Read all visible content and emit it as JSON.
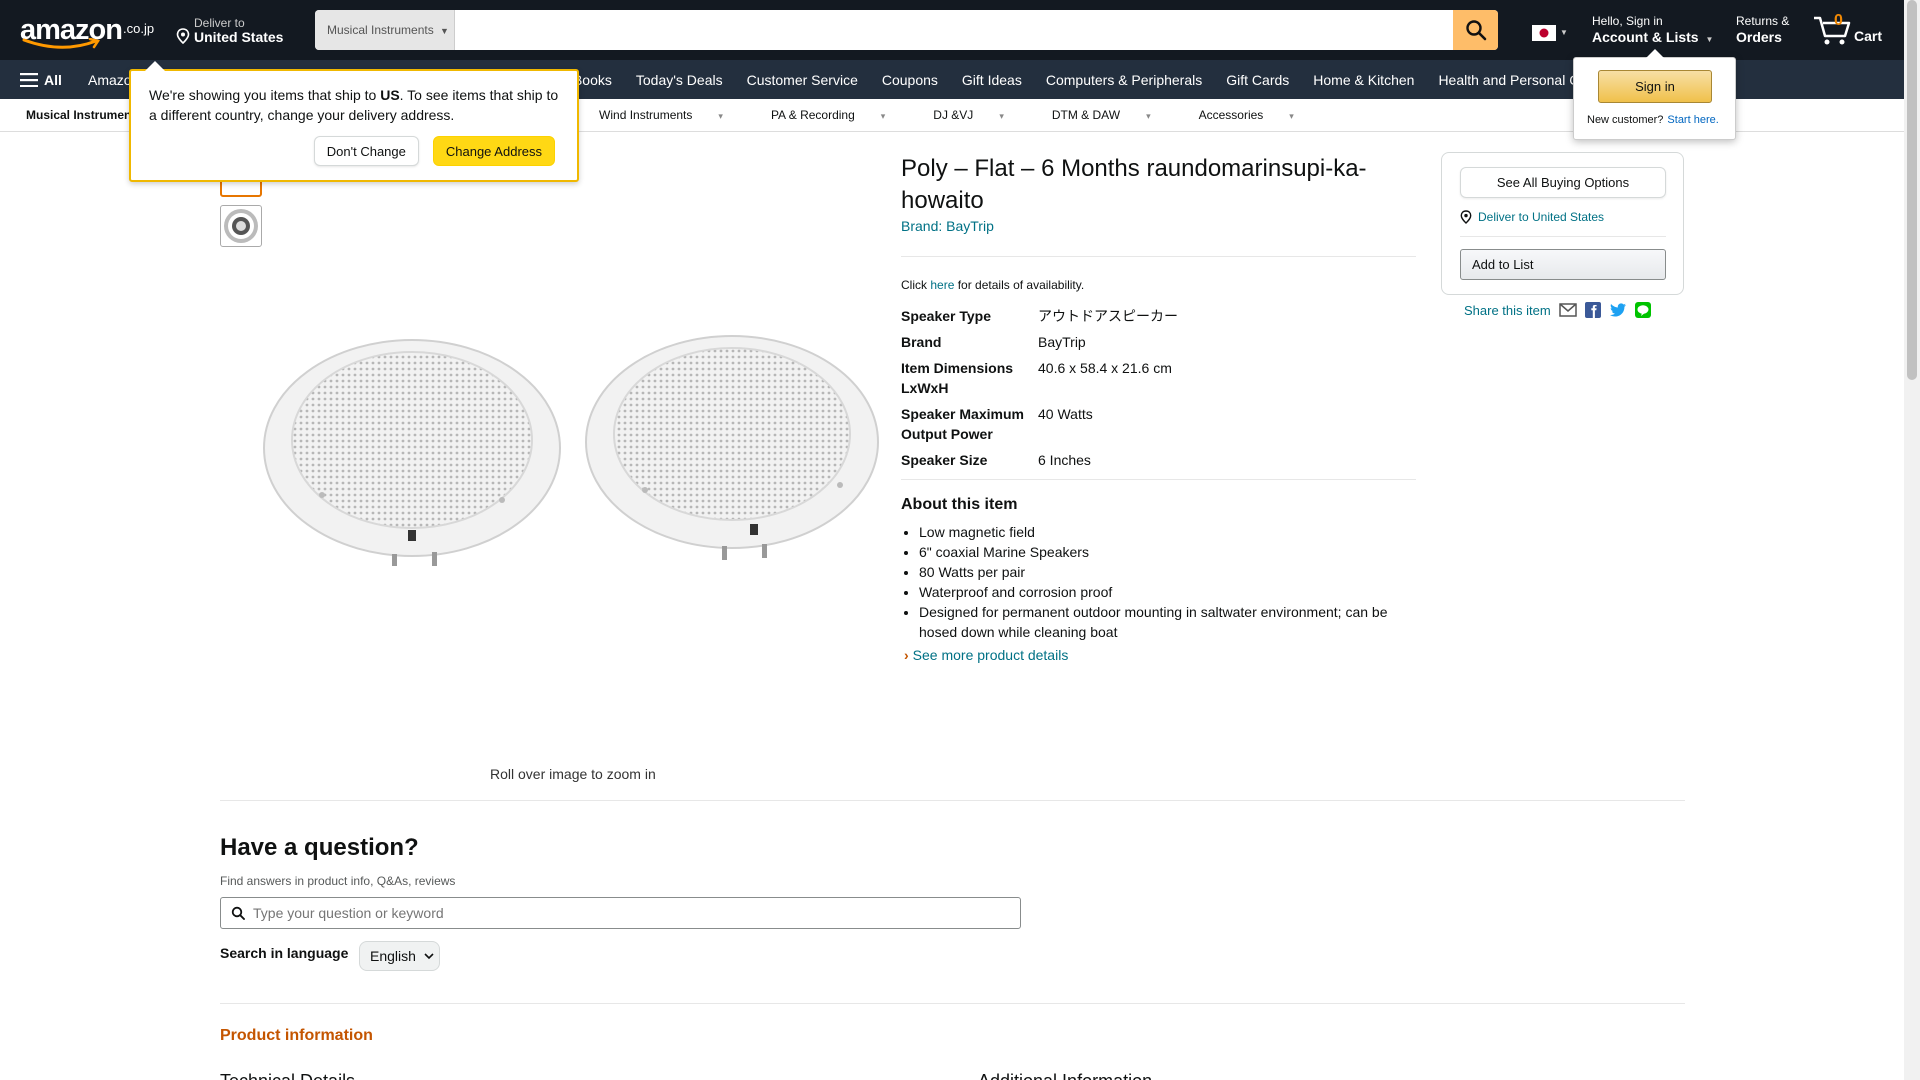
{
  "header": {
    "logo": "amazon",
    "logo_suffix": ".co.jp",
    "deliver_line1": "Deliver to",
    "deliver_line2": "United States",
    "search_category": "Musical Instruments",
    "search_placeholder": "",
    "account_line1": "Hello, Sign in",
    "account_line2": "Account & Lists",
    "returns_line1": "Returns &",
    "returns_line2": "Orders",
    "cart_count": "0",
    "cart_label": "Cart",
    "accent": "#febd69",
    "nav_bg": "#131921",
    "nav2_bg": "#232f3e"
  },
  "main_nav": {
    "all_label": "All",
    "items": [
      "Amazon",
      "Japanese Books",
      "Today's Deals",
      "Customer Service",
      "Coupons",
      "Gift Ideas",
      "Computers & Peripherals",
      "Gift Cards",
      "Home & Kitchen",
      "Health and Personal Care"
    ]
  },
  "sub_nav": {
    "items": [
      "Musical Instruments",
      "Wind Instruments",
      "PA & Recording",
      "DJ &VJ",
      "DTM & DAW",
      "Accessories"
    ]
  },
  "address_popover": {
    "text_before": "We're showing you items that ship to ",
    "text_bold": "US",
    "text_after": ". To see items that ship to a different country, change your delivery address.",
    "dont_change": "Don't Change",
    "change_address": "Change Address"
  },
  "signin_popover": {
    "button": "Sign in",
    "new_customer": "New customer?",
    "start_here": "Start here."
  },
  "product": {
    "title": "Poly – Flat – 6 Months raundomarinsupi-ka-howaito",
    "brand_link": "Brand: BayTrip",
    "availability_before": "Click ",
    "availability_link": "here",
    "availability_after": " for details of availability.",
    "zoom_hint": "Roll over image to zoom in",
    "specs": [
      {
        "key": "Speaker Type",
        "value": "アウトドアスピーカー"
      },
      {
        "key": "Brand",
        "value": "BayTrip"
      },
      {
        "key": "Item Dimensions LxWxH",
        "value": "40.6 x 58.4 x 21.6 cm"
      },
      {
        "key": "Speaker Maximum Output Power",
        "value": "40 Watts"
      },
      {
        "key": "Speaker Size",
        "value": "6 Inches"
      }
    ],
    "about_heading": "About this item",
    "about": [
      "Low magnetic field",
      "6\" coaxial Marine Speakers",
      "80 Watts per pair",
      "Waterproof and corrosion proof",
      "Designed for permanent outdoor mounting in saltwater environment; can be hosed down while cleaning boat"
    ],
    "see_more": "See more product details"
  },
  "buybox": {
    "see_all": "See All Buying Options",
    "deliver": "Deliver to United States",
    "add_to_list": "Add to List",
    "share": "Share this item"
  },
  "question": {
    "heading": "Have a question?",
    "subtitle": "Find answers in product info, Q&As, reviews",
    "placeholder": "Type your question or keyword",
    "lang_label": "Search in language",
    "lang_value": "English"
  },
  "product_info": {
    "heading": "Product information",
    "technical": "Technical Details",
    "additional": "Additional Information"
  }
}
